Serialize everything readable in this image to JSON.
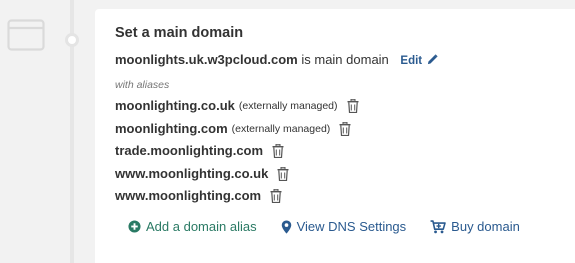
{
  "header": {
    "title": "Set a main domain"
  },
  "main_domain": {
    "domain": "moonlights.uk.w3pcloud.com",
    "suffix": "is main domain",
    "edit_label": "Edit"
  },
  "aliases_label": "with aliases",
  "aliases": [
    {
      "name": "moonlighting.co.uk",
      "note": "(externally managed)"
    },
    {
      "name": "moonlighting.com",
      "note": "(externally managed)"
    },
    {
      "name": "trade.moonlighting.com",
      "note": ""
    },
    {
      "name": "www.moonlighting.co.uk",
      "note": ""
    },
    {
      "name": "www.moonlighting.com",
      "note": ""
    }
  ],
  "actions": {
    "add_alias": "Add a domain alias",
    "view_dns": "View DNS Settings",
    "buy_domain": "Buy domain"
  },
  "colors": {
    "add_alias": "#2a7a64",
    "link": "#2a5a8f",
    "background": "#f2f2f2"
  },
  "icons": {
    "step": "browser-window-icon",
    "edit": "pencil-icon",
    "delete": "trash-icon",
    "add": "plus-circle-icon",
    "dns": "map-marker-icon",
    "buy": "cart-plus-icon"
  }
}
